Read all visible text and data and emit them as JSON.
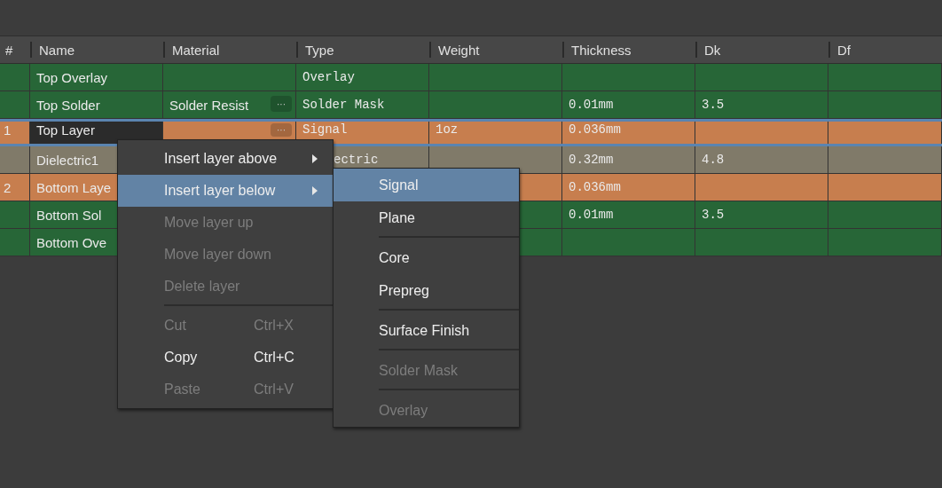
{
  "table": {
    "columns": [
      "#",
      "Name",
      "Material",
      "Type",
      "Weight",
      "Thickness",
      "Dk",
      "Df"
    ],
    "rows": [
      {
        "color": "#276637",
        "selected": false,
        "editing": false,
        "name": "Top Overlay",
        "type": "Overlay"
      },
      {
        "color": "#276637",
        "selected": false,
        "editing": false,
        "name": "Top Solder",
        "material": "Solder Resist",
        "material_button": "···",
        "type": "Solder Mask",
        "thickness": "0.01mm",
        "dk": "3.5"
      },
      {
        "color": "#c77e4e",
        "selected": true,
        "editing": true,
        "number": "1",
        "name": "Top Layer",
        "material_button": "···",
        "type": "Signal",
        "weight": "1oz",
        "thickness": "0.036mm"
      },
      {
        "color": "#807a69",
        "selected": false,
        "editing": false,
        "name": "Dielectric1",
        "type": "ectric",
        "thickness": "0.32mm",
        "dk": "4.8"
      },
      {
        "color": "#c77e4e",
        "selected": false,
        "editing": false,
        "number": "2",
        "name": "Bottom Laye",
        "thickness": "0.036mm"
      },
      {
        "color": "#276637",
        "selected": false,
        "editing": false,
        "name": "Bottom Sol",
        "thickness": "0.01mm",
        "dk": "3.5"
      },
      {
        "color": "#276637",
        "selected": false,
        "editing": false,
        "name": "Bottom Ove"
      }
    ]
  },
  "context_menu": {
    "items": [
      {
        "kind": "item",
        "label": "Insert layer above",
        "submenu": true,
        "disabled": false,
        "selected": false
      },
      {
        "kind": "item",
        "label": "Insert layer below",
        "submenu": true,
        "disabled": false,
        "selected": true
      },
      {
        "kind": "item",
        "label": "Move layer up",
        "submenu": false,
        "disabled": true,
        "selected": false
      },
      {
        "kind": "item",
        "label": "Move layer down",
        "submenu": false,
        "disabled": true,
        "selected": false
      },
      {
        "kind": "item",
        "label": "Delete layer",
        "submenu": false,
        "disabled": true,
        "selected": false
      },
      {
        "kind": "separator"
      },
      {
        "kind": "item",
        "label": "Cut",
        "shortcut": "Ctrl+X",
        "submenu": false,
        "disabled": true,
        "selected": false
      },
      {
        "kind": "item",
        "label": "Copy",
        "shortcut": "Ctrl+C",
        "submenu": false,
        "disabled": false,
        "selected": false
      },
      {
        "kind": "item",
        "label": "Paste",
        "shortcut": "Ctrl+V",
        "submenu": false,
        "disabled": true,
        "selected": false
      }
    ]
  },
  "submenu": {
    "items": [
      {
        "kind": "item",
        "label": "Signal",
        "disabled": false,
        "selected": true
      },
      {
        "kind": "item",
        "label": "Plane",
        "disabled": false,
        "selected": false
      },
      {
        "kind": "separator"
      },
      {
        "kind": "item",
        "label": "Core",
        "disabled": false,
        "selected": false
      },
      {
        "kind": "item",
        "label": "Prepreg",
        "disabled": false,
        "selected": false
      },
      {
        "kind": "separator"
      },
      {
        "kind": "item",
        "label": "Surface Finish",
        "disabled": false,
        "selected": false
      },
      {
        "kind": "separator"
      },
      {
        "kind": "item",
        "label": "Solder Mask",
        "disabled": true,
        "selected": false
      },
      {
        "kind": "separator"
      },
      {
        "kind": "item",
        "label": "Overlay",
        "disabled": true,
        "selected": false
      }
    ]
  }
}
